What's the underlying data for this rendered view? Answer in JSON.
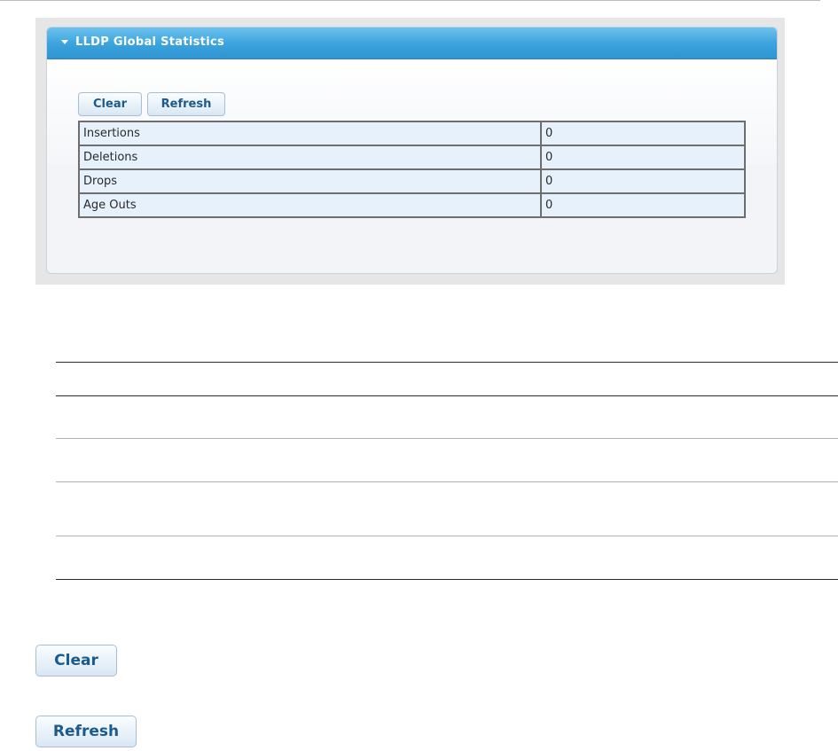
{
  "panel": {
    "title": "LLDP Global Statistics",
    "header_color": "#3aa2dc",
    "caret_icon": "caret-down-icon"
  },
  "toolbar": {
    "clear_label": "Clear",
    "refresh_label": "Refresh"
  },
  "statistics": [
    {
      "name": "Insertions",
      "value": "0"
    },
    {
      "name": "Deletions",
      "value": "0"
    },
    {
      "name": "Drops",
      "value": "0"
    },
    {
      "name": "Age Outs",
      "value": "0"
    }
  ],
  "buttons_legend": {
    "clear_label": "Clear",
    "refresh_label": "Refresh"
  }
}
